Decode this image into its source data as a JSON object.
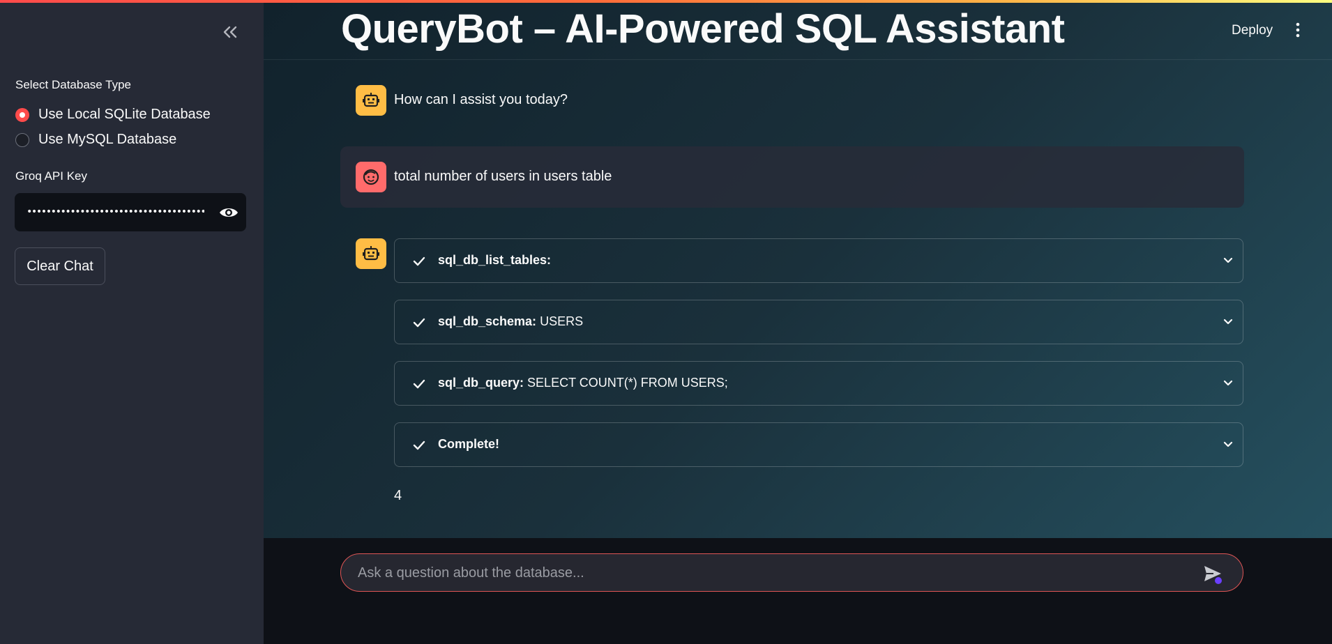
{
  "header": {
    "title": "QueryBot – AI-Powered SQL Assistant",
    "deploy_label": "Deploy"
  },
  "sidebar": {
    "db_type_label": "Select Database Type",
    "db_options": [
      {
        "label": "Use Local SQLite Database",
        "selected": true
      },
      {
        "label": "Use MySQL Database",
        "selected": false
      }
    ],
    "api_key_label": "Groq API Key",
    "api_key_masked": "••••••••••••••••••••••••••••••••••••••••",
    "clear_chat_label": "Clear Chat"
  },
  "chat": {
    "assistant_greeting": "How can I assist you today?",
    "user_message": "total number of users in users table",
    "steps": [
      {
        "tool": "sql_db_list_tables:",
        "detail": ""
      },
      {
        "tool": "sql_db_schema:",
        "detail": "USERS"
      },
      {
        "tool": "sql_db_query:",
        "detail": "SELECT COUNT(*) FROM USERS;"
      },
      {
        "tool": "Complete!",
        "detail": ""
      }
    ],
    "answer": "4"
  },
  "input": {
    "placeholder": "Ask a question about the database..."
  },
  "colors": {
    "accent": "#ff4b4b",
    "bot_avatar": "#ffbd45",
    "user_avatar": "#ff6b6b",
    "sidebar_bg": "#262a36"
  }
}
